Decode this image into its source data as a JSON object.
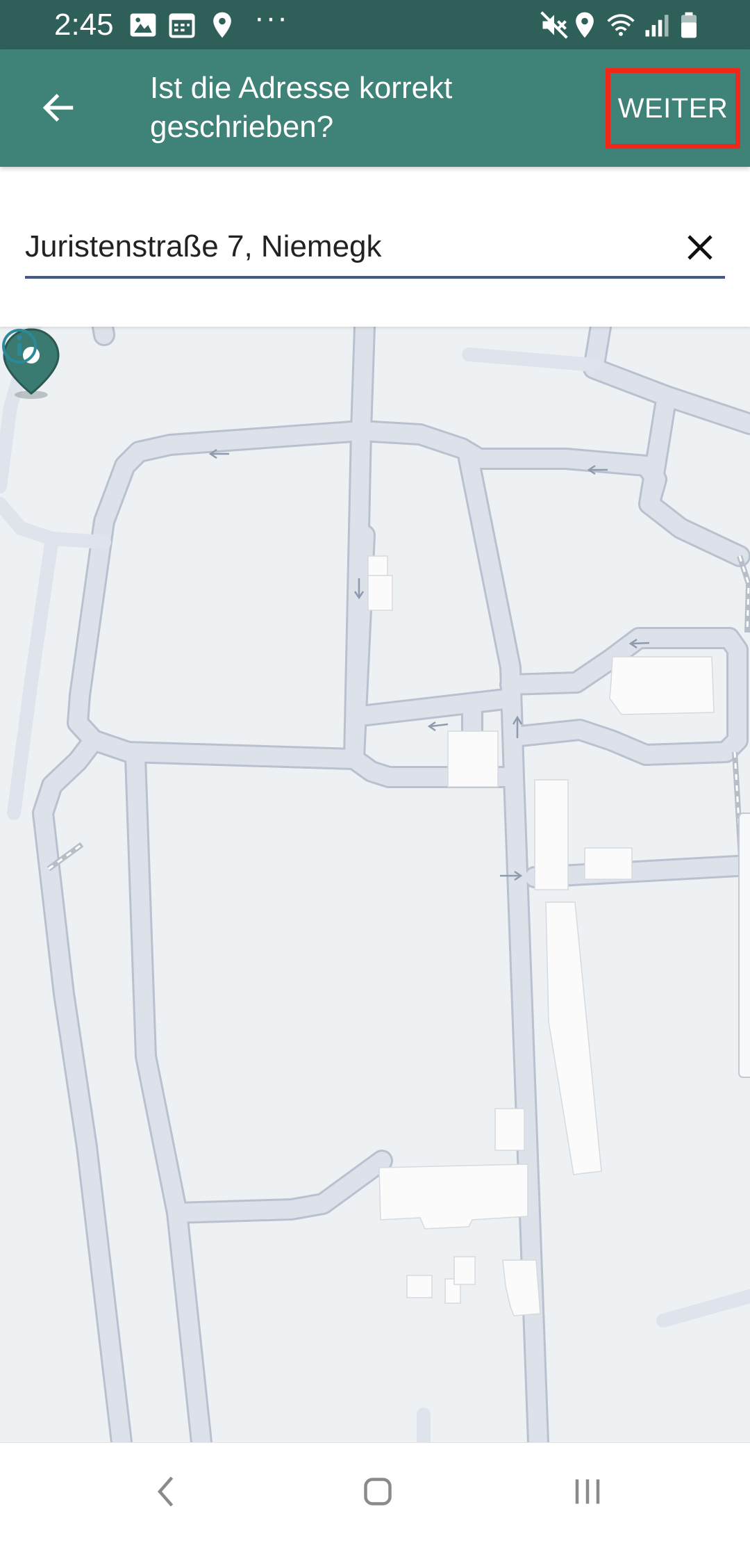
{
  "status_bar": {
    "time": "2:45",
    "dots": "···",
    "icons": [
      "gallery-icon",
      "calendar-icon",
      "location-icon",
      "mute-icon",
      "location-icon",
      "wifi-icon",
      "signal-icon",
      "battery-icon"
    ]
  },
  "app_bar": {
    "title": "Ist die Adresse korrekt geschrieben?",
    "next_label": "WEITER",
    "highlight_color": "#f0281a",
    "background_color": "#3e8278"
  },
  "search": {
    "value": "Juristenstraße 7, Niemegk",
    "underline_color": "#3f5a8a"
  },
  "map": {
    "background_color": "#edf1f3",
    "road_color": "#dce1ea",
    "marker_color": "#3a7a70"
  },
  "nav_bar": {
    "buttons": [
      "back-nav",
      "home-nav",
      "recents-nav"
    ]
  }
}
